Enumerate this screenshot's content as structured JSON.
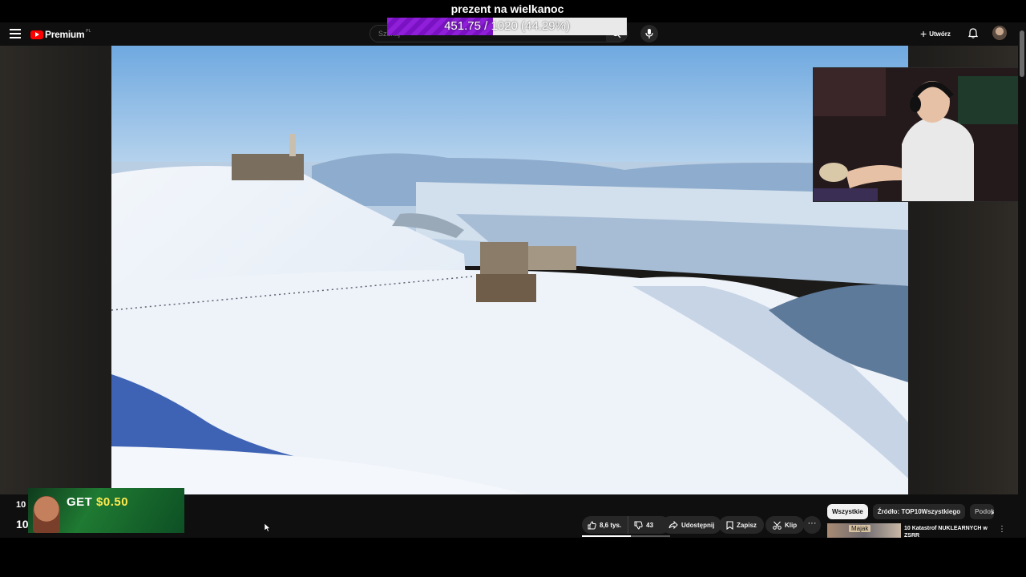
{
  "donation_goal": {
    "title": "prezent na wielkanoc",
    "progress_text": "451.75 / 1020 (44.29%)",
    "progress_fraction": 0.4429
  },
  "header": {
    "logo_text": "Premium",
    "logo_country": "PL",
    "search_placeholder": "Szukaj",
    "create_label": "Utwórz",
    "icons": [
      "menu-icon",
      "search-icon",
      "mic-icon",
      "bell-icon",
      "plus-icon"
    ]
  },
  "left_overlay": {
    "num_top": "10",
    "num_bottom": "10"
  },
  "ad": {
    "get_text": "GET",
    "amount_text": "$0.50"
  },
  "actions": {
    "likes": "8,6 tys.",
    "dislikes": "43",
    "share_label": "Udostępnij",
    "save_label": "Zapisz",
    "clip_label": "Klip",
    "more_label": "···",
    "like_ratio": 0.55
  },
  "chips": {
    "items": [
      "Wszystkie",
      "Źródło: TOP10Wszystkiego",
      "Podob"
    ],
    "active_index": 0
  },
  "recommendation": {
    "badge": "Majak",
    "title": "10 Katastrof NUKLEARNYCH w ZSRR"
  },
  "colors": {
    "accent_red": "#ff0000",
    "goal_purple": "#8f1fd8",
    "background": "#0f0f0f",
    "pill_bg": "#272727"
  }
}
